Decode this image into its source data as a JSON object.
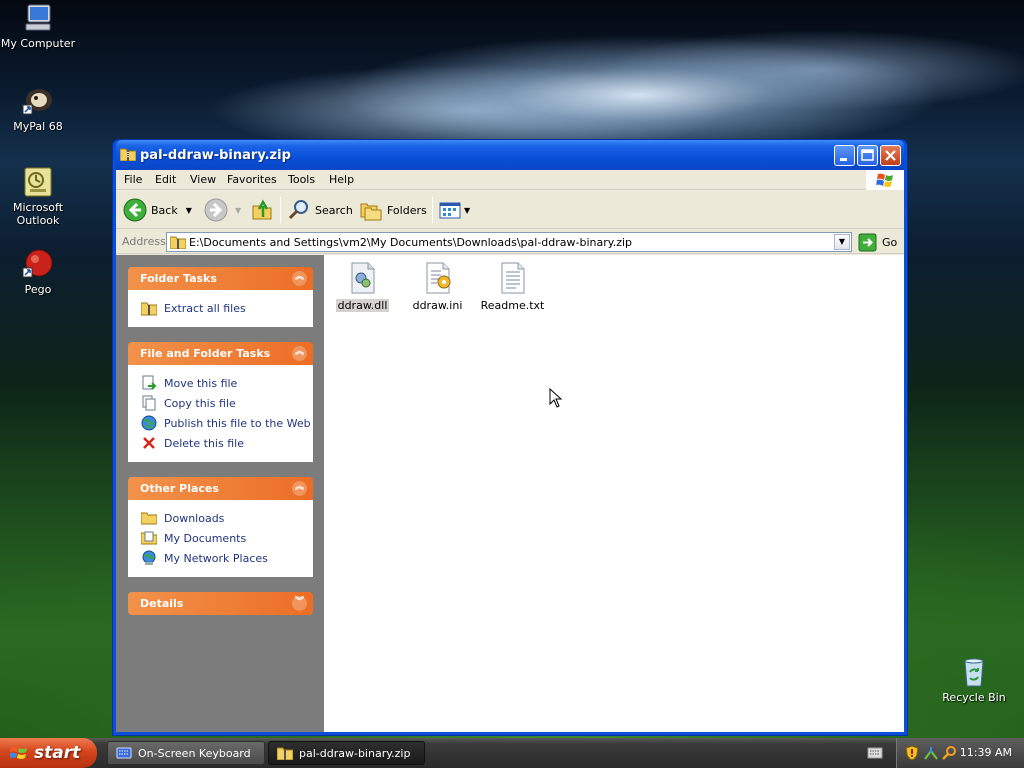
{
  "desktop": {
    "icons": [
      {
        "label": "My Computer"
      },
      {
        "label": "MyPal 68"
      },
      {
        "label": "Microsoft Outlook"
      },
      {
        "label": "Pego"
      },
      {
        "label": "Recycle Bin"
      }
    ]
  },
  "window": {
    "title": "pal-ddraw-binary.zip",
    "menu": [
      "File",
      "Edit",
      "View",
      "Favorites",
      "Tools",
      "Help"
    ],
    "toolbar": {
      "back_label": "Back",
      "search_label": "Search",
      "folders_label": "Folders"
    },
    "address": {
      "label": "Address",
      "value": "E:\\Documents and Settings\\vm2\\My Documents\\Downloads\\pal-ddraw-binary.zip",
      "go_label": "Go"
    },
    "panels": {
      "folder_tasks": {
        "title": "Folder Tasks",
        "items": [
          "Extract all files"
        ]
      },
      "file_folder_tasks": {
        "title": "File and Folder Tasks",
        "items": [
          "Move this file",
          "Copy this file",
          "Publish this file to the Web",
          "Delete this file"
        ]
      },
      "other_places": {
        "title": "Other Places",
        "items": [
          "Downloads",
          "My Documents",
          "My Network Places"
        ]
      },
      "details": {
        "title": "Details"
      }
    },
    "files": [
      {
        "name": "ddraw.dll",
        "selected": true
      },
      {
        "name": "ddraw.ini",
        "selected": false
      },
      {
        "name": "Readme.txt",
        "selected": false
      }
    ]
  },
  "taskbar": {
    "start_label": "start",
    "tasks": [
      {
        "label": "On-Screen Keyboard"
      },
      {
        "label": "pal-ddraw-binary.zip"
      }
    ],
    "clock": "11:39 AM"
  }
}
